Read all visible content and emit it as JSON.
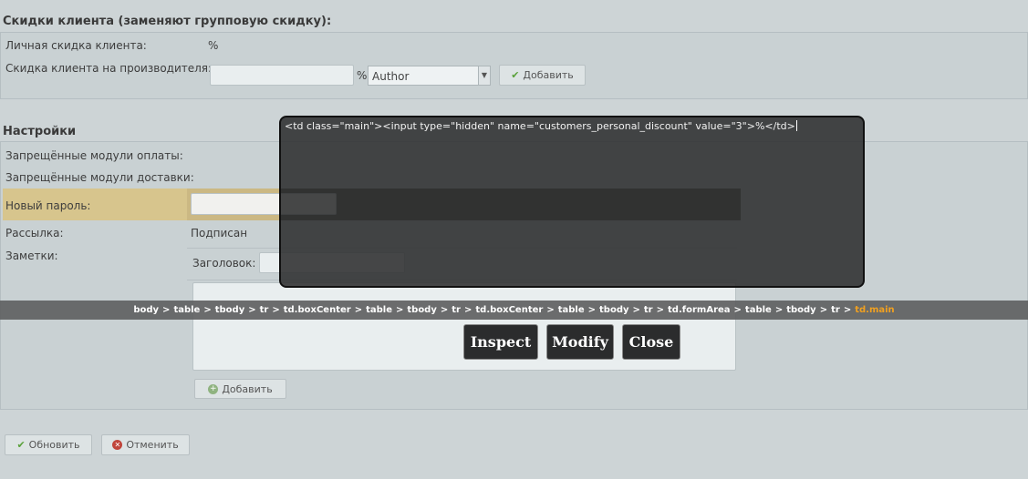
{
  "discounts": {
    "title": "Скидки клиента (заменяют групповую скидку):",
    "personal_label": "Личная скидка клиента:",
    "percent_sign": "%",
    "manufacturer_label": "Скидка клиента на производителя:",
    "manufacturer_input_value": "",
    "manufacturer_percent": "%",
    "manufacturer_select_value": "Author",
    "add_button_label": "Добавить"
  },
  "settings": {
    "title": "Настройки",
    "payment_label": "Запрещённые модули оплаты:",
    "shipping_label": "Запрещённые модули доставки:",
    "password_label": "Новый пароль:",
    "newsletter_label": "Рассылка:",
    "newsletter_value": "Подписан",
    "notes_label": "Заметки:",
    "heading_label": "Заголовок:",
    "add_note_button_label": "Добавить"
  },
  "footer": {
    "update_button_label": "Обновить",
    "cancel_button_label": "Отменить"
  },
  "inspector": {
    "code": "<td class=\"main\"><input type=\"hidden\" name=\"customers_personal_discount\" value=\"3\">%</td>",
    "path": [
      "body",
      "table",
      "tbody",
      "tr",
      "td.boxCenter",
      "table",
      "tbody",
      "tr",
      "td.boxCenter",
      "table",
      "tbody",
      "tr",
      "td.formArea",
      "table",
      "tbody",
      "tr"
    ],
    "path_current": "td.main",
    "path_separator": ">",
    "inspect_label": "Inspect",
    "modify_label": "Modify",
    "close_label": "Close"
  },
  "colors": {
    "page_bg": "#cdd4d6",
    "highlight_row": "#d7c58d",
    "overlay_bg": "#2e2f30",
    "path_current": "#f0a020"
  }
}
